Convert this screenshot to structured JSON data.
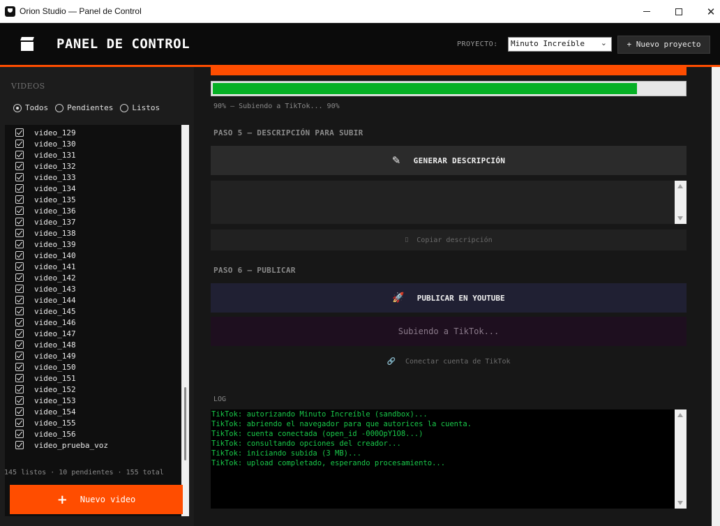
{
  "window": {
    "title": "Orion Studio — Panel de Control",
    "close_glyph": "✕"
  },
  "header": {
    "title": "PANEL DE CONTROL",
    "project_label": "PROYECTO:",
    "project_value": "Minuto Increíble",
    "chevron": "⌄",
    "new_project_label": "+ Nuevo proyecto",
    "accent_color": "#ff4d00"
  },
  "sidebar": {
    "title": "VIDEOS",
    "filters": [
      {
        "label": "Todos",
        "selected": true
      },
      {
        "label": "Pendientes",
        "selected": false
      },
      {
        "label": "Listos",
        "selected": false
      }
    ],
    "videos": [
      "video_129",
      "video_130",
      "video_131",
      "video_132",
      "video_133",
      "video_134",
      "video_135",
      "video_136",
      "video_137",
      "video_138",
      "video_139",
      "video_140",
      "video_141",
      "video_142",
      "video_143",
      "video_144",
      "video_145",
      "video_146",
      "video_147",
      "video_148",
      "video_149",
      "video_150",
      "video_151",
      "video_152",
      "video_153",
      "video_154",
      "video_155",
      "video_156",
      "video_prueba_voz"
    ],
    "stats": "145 listos · 10 pendientes · 155 total",
    "new_video": {
      "icon": "+",
      "label": "Nuevo video"
    }
  },
  "main": {
    "progress": {
      "value": 0.9,
      "text": "90% — Subiendo a TikTok... 90%",
      "color": "#06b025"
    },
    "step5": {
      "title": "PASO 5 — DESCRIPCIÓN PARA SUBIR",
      "generate_label": "GENERAR DESCRIPCIÓN",
      "generate_icon": "✎",
      "description_value": "",
      "copy_label": "Copiar descripción",
      "copy_icon": "▯"
    },
    "step6": {
      "title": "PASO 6 — PUBLICAR",
      "publish_label": "PUBLICAR EN YOUTUBE",
      "publish_icon": "🚀",
      "uploading_label": "Subiendo a TikTok...",
      "connect_label": "Conectar cuenta de TikTok",
      "connect_icon": "🔗"
    },
    "log": {
      "label": "LOG",
      "lines": [
        "TikTok: autorizando Minuto Increíble (sandbox)...",
        "TikTok: abriendo el navegador para que autorices la cuenta.",
        "TikTok: cuenta conectada (open_id -000OpY1O8...)",
        "TikTok: consultando opciones del creador...",
        "TikTok: iniciando subida (3 MB)...",
        "TikTok: upload completado, esperando procesamiento..."
      ]
    }
  }
}
